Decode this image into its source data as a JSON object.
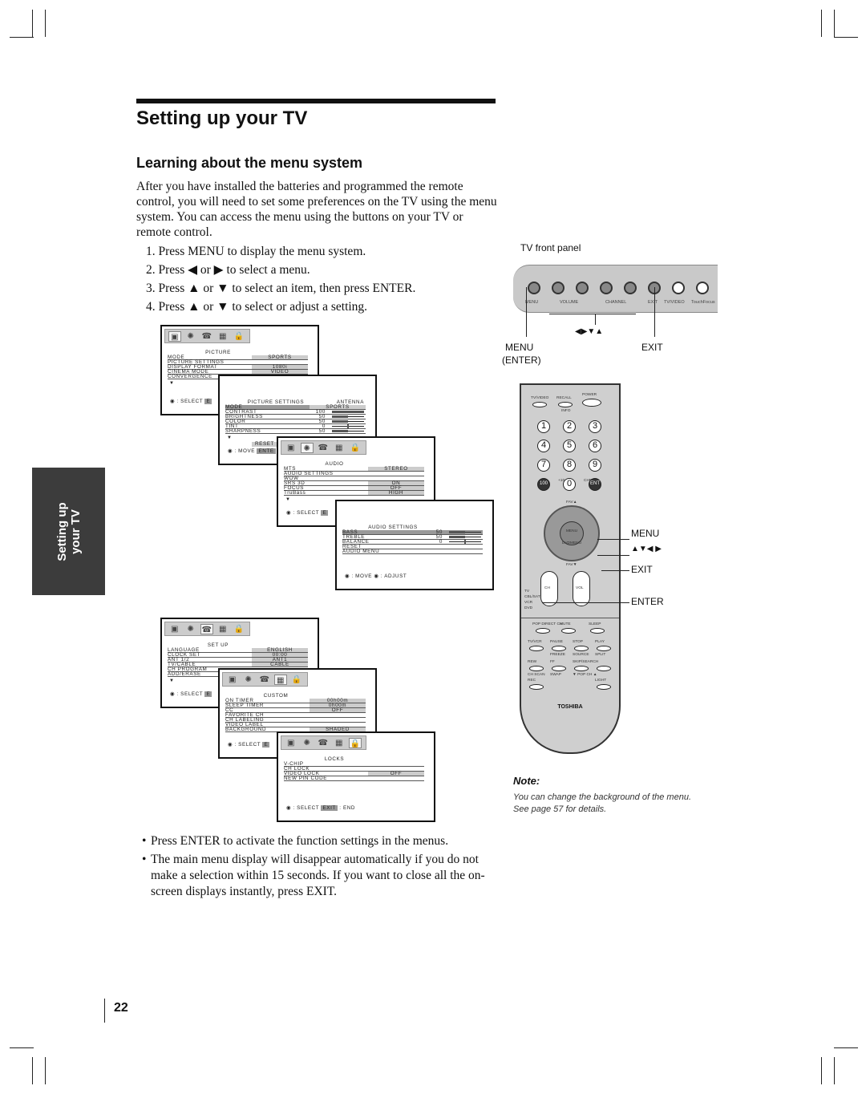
{
  "header": {
    "title": "Setting up your TV"
  },
  "section": {
    "title": "Learning about the menu system",
    "intro": "After you have installed the batteries and programmed the remote control, you will need to set some preferences on the TV using the menu system. You can access the menu using the buttons on your TV or remote control.",
    "steps": [
      "1. Press MENU to display the menu system.",
      "2. Press ◀ or ▶ to select a menu.",
      "3. Press ▲ or ▼ to select an item, then press ENTER.",
      "4. Press ▲ or ▼ to select or adjust a setting."
    ]
  },
  "side_tab": {
    "line1": "Setting up",
    "line2": "your TV"
  },
  "menus": [
    {
      "active": 0,
      "title": "PICTURE",
      "rows": [
        [
          "MODE",
          "SPORTS"
        ],
        [
          "PICTURE SETTINGS",
          ""
        ],
        [
          "DISPLAY FORMAT",
          "1080i"
        ],
        [
          "CINEMA MODE",
          "VIDEO"
        ],
        [
          "CONVERGENCE",
          ""
        ]
      ],
      "foot": "◉ : SELECT",
      "foot_key": "E"
    },
    {
      "active": -1,
      "title": "PICTURE SETTINGS",
      "title2": "ANTENNA",
      "rows": [
        [
          "MODE",
          "SPORTS"
        ],
        [
          "CONTRAST",
          "100",
          100
        ],
        [
          "BRIGHTNESS",
          "50",
          50
        ],
        [
          "COLOR",
          "50",
          50
        ],
        [
          "TINT",
          "0",
          0
        ],
        [
          "SHARPNESS",
          "50",
          50
        ]
      ],
      "sel": 0,
      "reset": "RESET",
      "foot": "◉ : MOVE",
      "foot_key": "ENTE"
    },
    {
      "active": 1,
      "title": "AUDIO",
      "rows": [
        [
          "MTS",
          "STEREO"
        ],
        [
          "AUDIO SETTINGS",
          ""
        ],
        [
          "WOW",
          ""
        ],
        [
          "  SRS 3D",
          "ON"
        ],
        [
          "  FOCUS",
          "OFF"
        ],
        [
          "  TruBass",
          "HIGH"
        ]
      ],
      "foot": "◉ : SELECT",
      "foot_key": "E"
    },
    {
      "active": -1,
      "title": "AUDIO SETTINGS",
      "rows": [
        [
          "BASS",
          "50",
          50
        ],
        [
          "TREBLE",
          "50",
          50
        ],
        [
          "BALANCE",
          "0",
          0
        ],
        [
          "RESET",
          ""
        ],
        [
          "AUDIO MENU",
          ""
        ]
      ],
      "sel": 0,
      "foot": "◉ : MOVE    ◉ : ADJUST"
    },
    {
      "active": 2,
      "title": "SET UP",
      "rows": [
        [
          "LANGUAGE",
          "ENGLISH"
        ],
        [
          "CLOCK SET",
          "00:00"
        ],
        [
          "ANT 1/2",
          "ANT1"
        ],
        [
          "TV/CABLE",
          "CABLE"
        ],
        [
          "CH PROGRAM",
          ""
        ],
        [
          "ADD/ERASE",
          ""
        ]
      ],
      "foot": "◉ : SELECT",
      "foot_key": "E"
    },
    {
      "active": 3,
      "title": "CUSTOM",
      "rows": [
        [
          "ON TIMER",
          "00h00m"
        ],
        [
          "SLEEP TIMER",
          "0h00m"
        ],
        [
          "CC",
          "OFF"
        ],
        [
          "FAVORITE CH",
          ""
        ],
        [
          "CH LABELING",
          ""
        ],
        [
          "VIDEO LABEL",
          ""
        ],
        [
          "BACKGROUND",
          "SHADED"
        ]
      ],
      "foot": "◉ : SELECT",
      "foot_key": "E"
    },
    {
      "active": 4,
      "title": "LOCKS",
      "rows": [
        [
          "V-CHIP",
          ""
        ],
        [
          "CH LOCK",
          ""
        ],
        [
          "VIDEO LOCK",
          "OFF"
        ],
        [
          "NEW PIN CODE",
          ""
        ]
      ],
      "foot": "◉ : SELECT",
      "foot_key": "EXIT",
      "foot_end": ": END"
    }
  ],
  "front_panel": {
    "caption": "TV front panel",
    "labels": [
      "MENU",
      "VOLUME",
      "CHANNEL",
      "EXIT",
      "TV/VIDEO",
      "TouchFocus"
    ],
    "arrows": "◀▶▼▲",
    "menu_callout": "MENU",
    "enter_callout": "(ENTER)",
    "exit_callout": "EXIT"
  },
  "remote": {
    "top": [
      "TV/VIDEO",
      "RECALL",
      "POWER",
      "INFO"
    ],
    "numbers": [
      "1",
      "2",
      "3",
      "4",
      "5",
      "6",
      "7",
      "8",
      "9",
      "100",
      "0",
      "ENT"
    ],
    "plus10": "+10",
    "chrtn": "CHRTN",
    "fav_up": "FAV▲",
    "fav_down": "FAV▼",
    "menu": "MENU",
    "dvdmenu": "DVDMENU",
    "ch": "CH",
    "vol": "VOL",
    "modes": [
      "TV",
      "CBL/SAT",
      "VCR",
      "DVD"
    ],
    "row1": [
      "POP DIRECT CH",
      "MUTE",
      "SLEEP"
    ],
    "row2": [
      "TV/VCR",
      "PAUSE",
      "STOP",
      "PLAY"
    ],
    "row3": [
      "FREEZE",
      "SOURCE",
      "SPLIT"
    ],
    "row4": [
      "REW",
      "FF",
      "SKIP/SEARCH"
    ],
    "row5": [
      "CH SCAN",
      "SWAP",
      "▼ POP CH ▲"
    ],
    "row6": [
      "REC",
      "LIGHT"
    ],
    "brand": "TOSHIBA",
    "callouts": [
      "MENU",
      "▲▼◀ ▶",
      "EXIT",
      "ENTER"
    ]
  },
  "note": {
    "heading": "Note:",
    "text": "You can change the background of the menu. See page 57 for details."
  },
  "bullets": [
    "Press ENTER to activate the function settings in the menus.",
    "The main menu display will disappear automatically if you do not make a selection within 15 seconds. If you want to close all the on-screen displays instantly, press EXIT."
  ],
  "page_number": "22"
}
